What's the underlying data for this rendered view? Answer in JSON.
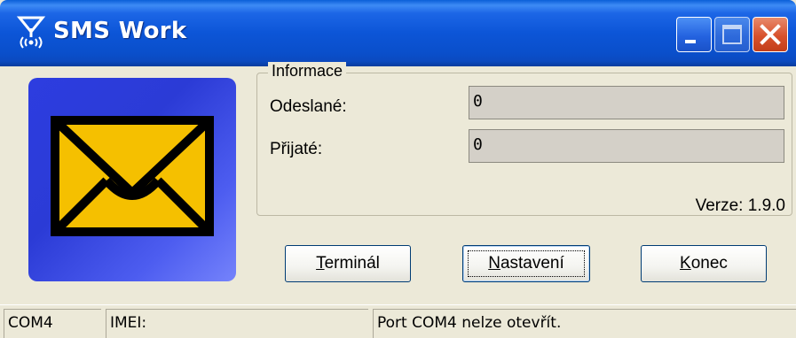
{
  "window": {
    "title": "SMS Work",
    "icon": "antenna-icon"
  },
  "titlebar_buttons": {
    "minimize_icon": "minimize-icon",
    "maximize_icon": "maximize-icon",
    "close_icon": "close-icon"
  },
  "logo": {
    "icon": "envelope-icon",
    "bg_color": "#2d3de0",
    "envelope_color": "#f5c000"
  },
  "info": {
    "group_title": "Informace",
    "sent_label": "Odeslané:",
    "sent_value": "0",
    "received_label": "Přijaté:",
    "received_value": "0",
    "version": "Verze: 1.9.0"
  },
  "buttons": {
    "terminal": {
      "first": "T",
      "rest": "erminál"
    },
    "settings": {
      "first": "N",
      "rest": "astavení"
    },
    "exit": {
      "first": "K",
      "rest": "onec"
    }
  },
  "statusbar": {
    "port": "COM4",
    "imei": "IMEI:",
    "message": "Port COM4 nelze otevřít."
  }
}
